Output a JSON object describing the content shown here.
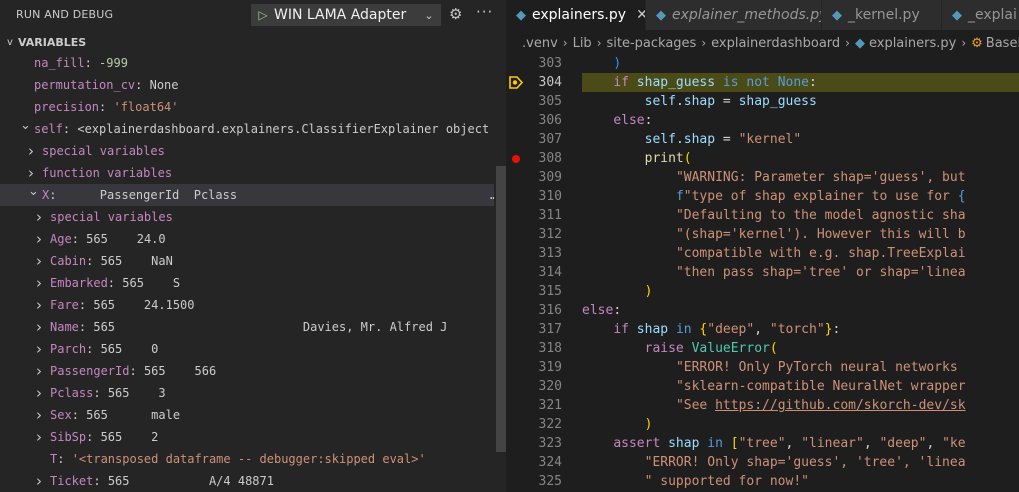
{
  "debug_panel": {
    "title": "RUN AND DEBUG",
    "config_name": "WIN LAMA Adapter",
    "variables_header": "VARIABLES",
    "rows": [
      {
        "indent": 1,
        "chevron": "",
        "name": "na_fill",
        "sep": ": ",
        "value": "-999",
        "vtype": "num"
      },
      {
        "indent": 1,
        "chevron": "",
        "name": "permutation_cv",
        "sep": ": ",
        "value": "None",
        "vtype": "plain"
      },
      {
        "indent": 1,
        "chevron": "",
        "name": "precision",
        "sep": ": ",
        "value": "'float64'",
        "vtype": "str"
      },
      {
        "indent": 1,
        "chevron": "v",
        "name": "self",
        "sep": ": ",
        "value": "<explainerdashboard.explainers.ClassifierExplainer object a…",
        "vtype": "plain"
      },
      {
        "indent": 2,
        "chevron": ">",
        "name": "special variables",
        "sep": "",
        "value": "",
        "vtype": "plain"
      },
      {
        "indent": 2,
        "chevron": ">",
        "name": "function variables",
        "sep": "",
        "value": "",
        "vtype": "plain"
      },
      {
        "indent": 2,
        "chevron": "v",
        "name": "X",
        "sep": ": ",
        "value": "     PassengerId  Pclass",
        "vtype": "plain",
        "selected": true,
        "trailing": "…"
      },
      {
        "indent": 3,
        "chevron": ">",
        "name": "special variables",
        "sep": "",
        "value": "",
        "vtype": "plain"
      },
      {
        "indent": 3,
        "chevron": ">",
        "name": "Age",
        "sep": ": ",
        "value": "565    24.0",
        "vtype": "plain"
      },
      {
        "indent": 3,
        "chevron": ">",
        "name": "Cabin",
        "sep": ": ",
        "value": "565    NaN",
        "vtype": "plain"
      },
      {
        "indent": 3,
        "chevron": ">",
        "name": "Embarked",
        "sep": ": ",
        "value": "565    S",
        "vtype": "plain"
      },
      {
        "indent": 3,
        "chevron": ">",
        "name": "Fare",
        "sep": ": ",
        "value": "565    24.1500",
        "vtype": "plain"
      },
      {
        "indent": 3,
        "chevron": ">",
        "name": "Name",
        "sep": ": ",
        "value": "565                          Davies, Mr. Alfred J",
        "vtype": "plain"
      },
      {
        "indent": 3,
        "chevron": ">",
        "name": "Parch",
        "sep": ": ",
        "value": "565    0",
        "vtype": "plain"
      },
      {
        "indent": 3,
        "chevron": ">",
        "name": "PassengerId",
        "sep": ": ",
        "value": "565    566",
        "vtype": "plain"
      },
      {
        "indent": 3,
        "chevron": ">",
        "name": "Pclass",
        "sep": ": ",
        "value": "565    3",
        "vtype": "plain"
      },
      {
        "indent": 3,
        "chevron": ">",
        "name": "Sex",
        "sep": ": ",
        "value": "565      male",
        "vtype": "plain"
      },
      {
        "indent": 3,
        "chevron": ">",
        "name": "SibSp",
        "sep": ": ",
        "value": "565    2",
        "vtype": "plain"
      },
      {
        "indent": 4,
        "chevron": "",
        "name": "T",
        "sep": ": ",
        "value": "'<transposed dataframe -- debugger:skipped eval>'",
        "vtype": "str"
      },
      {
        "indent": 3,
        "chevron": ">",
        "name": "Ticket",
        "sep": ": ",
        "value": "565           A/4 48871",
        "vtype": "plain"
      }
    ]
  },
  "editor": {
    "tabs": [
      {
        "label": "explainers.py",
        "active": true,
        "italic": false,
        "close": "✕"
      },
      {
        "label": "explainer_methods.py",
        "active": false,
        "italic": true,
        "close": ""
      },
      {
        "label": "_kernel.py",
        "active": false,
        "italic": false,
        "close": ""
      },
      {
        "label": "_explai",
        "active": false,
        "italic": false,
        "close": ""
      }
    ],
    "breadcrumb": [
      ".venv",
      "Lib",
      "site-packages",
      "explainerdashboard",
      "explainers.py",
      "BaseExplai"
    ],
    "current_line": 304,
    "breakpoint_line": 308,
    "lines": [
      {
        "n": "303",
        "indent": 12,
        "tokens": [
          [
            "br3",
            ")"
          ]
        ]
      },
      {
        "n": "304",
        "indent": 12,
        "tokens": [
          [
            "kw",
            "if"
          ],
          [
            "op",
            " "
          ],
          [
            "vr",
            "shap_guess"
          ],
          [
            "op",
            " "
          ],
          [
            "kb",
            "is not"
          ],
          [
            "op",
            " "
          ],
          [
            "kb",
            "None"
          ],
          [
            "op",
            ":"
          ]
        ]
      },
      {
        "n": "305",
        "indent": 16,
        "tokens": [
          [
            "vr",
            "self"
          ],
          [
            "op",
            "."
          ],
          [
            "vr",
            "shap"
          ],
          [
            "op",
            " = "
          ],
          [
            "vr",
            "shap_guess"
          ]
        ]
      },
      {
        "n": "306",
        "indent": 12,
        "tokens": [
          [
            "kw",
            "else"
          ],
          [
            "op",
            ":"
          ]
        ]
      },
      {
        "n": "307",
        "indent": 16,
        "tokens": [
          [
            "vr",
            "self"
          ],
          [
            "op",
            "."
          ],
          [
            "vr",
            "shap"
          ],
          [
            "op",
            " = "
          ],
          [
            "st",
            "\"kernel\""
          ]
        ]
      },
      {
        "n": "308",
        "indent": 16,
        "tokens": [
          [
            "fn",
            "print"
          ],
          [
            "br1",
            "("
          ]
        ]
      },
      {
        "n": "309",
        "indent": 20,
        "tokens": [
          [
            "st",
            "\"WARNING: Parameter shap='guess', but"
          ]
        ]
      },
      {
        "n": "310",
        "indent": 20,
        "tokens": [
          [
            "kb",
            "f"
          ],
          [
            "st",
            "\"type of shap explainer to use for "
          ],
          [
            "kb",
            "{"
          ]
        ]
      },
      {
        "n": "311",
        "indent": 20,
        "tokens": [
          [
            "st",
            "\"Defaulting to the model agnostic sha"
          ]
        ]
      },
      {
        "n": "312",
        "indent": 20,
        "tokens": [
          [
            "st",
            "\"(shap='kernel'). However this will b"
          ]
        ]
      },
      {
        "n": "313",
        "indent": 20,
        "tokens": [
          [
            "st",
            "\"compatible with e.g. shap.TreeExplai"
          ]
        ]
      },
      {
        "n": "314",
        "indent": 20,
        "tokens": [
          [
            "st",
            "\"then pass shap='tree' or shap='linea"
          ]
        ]
      },
      {
        "n": "315",
        "indent": 16,
        "tokens": [
          [
            "br1",
            ")"
          ]
        ]
      },
      {
        "n": "316",
        "indent": 8,
        "tokens": [
          [
            "kw",
            "else"
          ],
          [
            "op",
            ":"
          ]
        ]
      },
      {
        "n": "317",
        "indent": 12,
        "tokens": [
          [
            "kw",
            "if"
          ],
          [
            "op",
            " "
          ],
          [
            "vr",
            "shap"
          ],
          [
            "op",
            " "
          ],
          [
            "kb",
            "in"
          ],
          [
            "op",
            " "
          ],
          [
            "br1",
            "{"
          ],
          [
            "st",
            "\"deep\""
          ],
          [
            "op",
            ", "
          ],
          [
            "st",
            "\"torch\""
          ],
          [
            "br1",
            "}"
          ],
          [
            "op",
            ":"
          ]
        ]
      },
      {
        "n": "318",
        "indent": 16,
        "tokens": [
          [
            "kw",
            "raise"
          ],
          [
            "op",
            " "
          ],
          [
            "cls",
            "ValueError"
          ],
          [
            "br1",
            "("
          ]
        ]
      },
      {
        "n": "319",
        "indent": 20,
        "tokens": [
          [
            "st",
            "\"ERROR! Only PyTorch neural networks"
          ]
        ]
      },
      {
        "n": "320",
        "indent": 20,
        "tokens": [
          [
            "st",
            "\"sklearn-compatible NeuralNet wrapper"
          ]
        ]
      },
      {
        "n": "321",
        "indent": 20,
        "tokens": [
          [
            "st",
            "\"See "
          ],
          [
            "sl",
            "https://github.com/skorch-dev/sk"
          ]
        ]
      },
      {
        "n": "322",
        "indent": 16,
        "tokens": [
          [
            "br1",
            ")"
          ]
        ]
      },
      {
        "n": "323",
        "indent": 12,
        "tokens": [
          [
            "kw",
            "assert"
          ],
          [
            "op",
            " "
          ],
          [
            "vr",
            "shap"
          ],
          [
            "op",
            " "
          ],
          [
            "kb",
            "in"
          ],
          [
            "op",
            " "
          ],
          [
            "br1",
            "["
          ],
          [
            "st",
            "\"tree\""
          ],
          [
            "op",
            ", "
          ],
          [
            "st",
            "\"linear\""
          ],
          [
            "op",
            ", "
          ],
          [
            "st",
            "\"deep\""
          ],
          [
            "op",
            ", "
          ],
          [
            "st",
            "\"ke"
          ]
        ]
      },
      {
        "n": "324",
        "indent": 16,
        "tokens": [
          [
            "st",
            "\"ERROR! Only shap='guess', 'tree', 'linea"
          ]
        ]
      },
      {
        "n": "325",
        "indent": 16,
        "tokens": [
          [
            "st",
            "\" supported for now!\""
          ]
        ]
      }
    ]
  }
}
